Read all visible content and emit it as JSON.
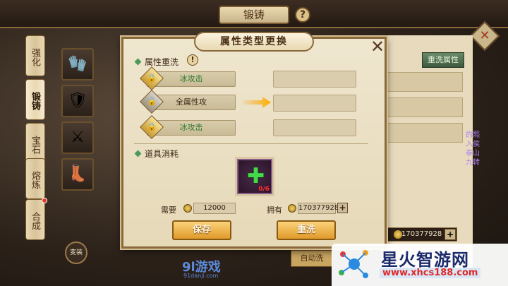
{
  "base_window": {
    "title": "锻铸",
    "help_label": "?",
    "tabs": [
      {
        "label": "强化",
        "active": false
      },
      {
        "label": "锻铸",
        "active": true
      },
      {
        "label": "宝石",
        "active": false
      },
      {
        "label": "熔炼",
        "active": false
      },
      {
        "label": "合成",
        "active": false
      }
    ],
    "rewash_button": "重洗属性",
    "own_amount": "170377928",
    "auto_button": "自动洗",
    "seal_label": "变装",
    "chat_lines": [
      "的熙",
      "入侯",
      "泰山",
      "九转"
    ]
  },
  "modal": {
    "title": "属性类型更换",
    "close_label": "✕",
    "section_rewash": "属性重洗",
    "warn_icon": "!",
    "attributes": [
      {
        "label": "冰攻击",
        "locked": true,
        "color": "green"
      },
      {
        "label": "全属性攻",
        "locked": false,
        "color": "dark"
      },
      {
        "label": "冰攻击",
        "locked": true,
        "color": "green"
      }
    ],
    "section_consume": "道具消耗",
    "item_count": "0/6",
    "need_label": "需要",
    "need_value": "12000",
    "own_label": "拥有",
    "own_value": "170377928",
    "save_button": "保存",
    "rewash_button": "重洗"
  },
  "watermarks": {
    "left_brand": "9l游戏",
    "left_url": "91danji.com",
    "right_brand": "星火智游网",
    "right_url": "www.xhcs188.com"
  },
  "colors": {
    "accent_gold": "#e09a2a",
    "green_text": "#2e7a2e",
    "panel_bg": "#efe6cf"
  }
}
